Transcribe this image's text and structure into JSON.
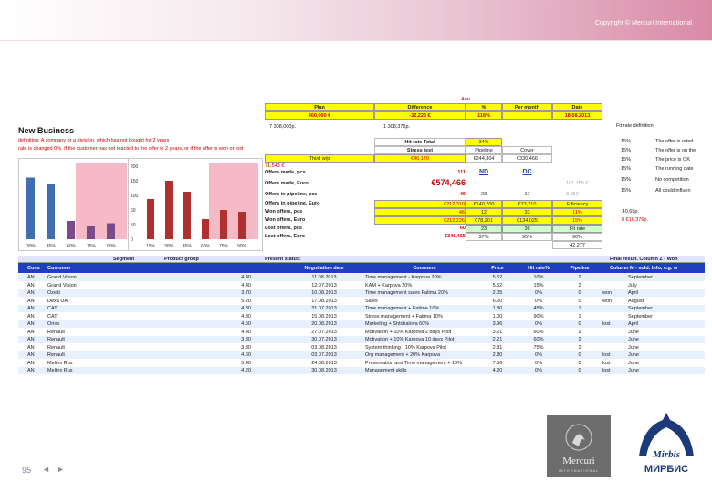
{
  "header": {
    "copyright": "Copyright © Mercuri International"
  },
  "slide": {
    "page_number": "95",
    "nav_prev": "◄",
    "nav_next": "►"
  },
  "sheet": {
    "section_title": "New Business",
    "definition_line1": "definition: A company or a division, which has not bought for 2 years",
    "definition_line2": "rate is changed 0%. If the customer has not reacted to the offer in 2 years, or if the offer is won or lost",
    "top_label": "Ann",
    "summary_headers": [
      "Plan",
      "Difference",
      "%",
      "Per month",
      "Date"
    ],
    "summary_values": [
      "460,000 €",
      "-32,226 €",
      "118%",
      "",
      "18.08.2013"
    ],
    "plan_rub": "7 308,000р.",
    "diff_rub": "1 308,376р.",
    "hit_rate_total_label": "Hit rate Total",
    "hit_rate_total_value": "34%",
    "stress_test_label": "Stress test",
    "pipeline_label": "Pipeline",
    "cover_label": "Cover",
    "pipeline_value": "€244,304",
    "cover_value": "€330,466",
    "sum_label": "Third w/p",
    "sum_value": "€46,170",
    "sum_value2": "71,543 €",
    "metrics": [
      {
        "label": "Offers made, pcs",
        "v1": "111",
        "v2": "ND",
        "v3": "DC"
      },
      {
        "label": "Offers made, Euro",
        "v1": "€574,466",
        "v2": "",
        "v3": ""
      },
      {
        "label": "Offers in pipeline, pcs",
        "v1": "46",
        "v2": "23",
        "v3": "17"
      },
      {
        "label": "Offers in pipeline, Euro",
        "v1": "€212,310",
        "v2": "€140,700",
        "v3": "€73,210"
      },
      {
        "label": "Won offers, pcs",
        "v1": "46",
        "v2": "12",
        "v3": "33"
      },
      {
        "label": "Won offers, Euro",
        "v1": "€212,226",
        "v2": "€78,201",
        "v3": "€134,025"
      },
      {
        "label": "Lost offers, pcs",
        "v1": "60",
        "v2": "23",
        "v3": "36"
      },
      {
        "label": "Lost offers, Euro",
        "v1": "€346,465",
        "v2": "",
        "v3": ""
      }
    ],
    "efficiency_label": "Efficiency",
    "efficiency_values": [
      "11%",
      "15%",
      "40.65р.",
      "8 616,376р."
    ],
    "hit_rate_row": [
      "37%",
      "95%",
      "Fit rate",
      "90%",
      "42,277"
    ],
    "right_percent_col": [
      "15%",
      "15%",
      "15%",
      "15%",
      "15%",
      "15%"
    ],
    "right_notes": [
      "The offer is rated",
      "The offer is on the",
      "The price is OK",
      "The running date",
      "No competition",
      "All could influen"
    ],
    "fit_definition": "Fit rate definition",
    "side_values": [
      "161,155 €",
      "3,052"
    ],
    "chart1": {
      "title": "",
      "xlabels": [
        "30%",
        "45%",
        "60%",
        "75%",
        "90%"
      ],
      "values": [
        135,
        120,
        40,
        30,
        35
      ]
    },
    "chart2": {
      "title": "",
      "xlabels": [
        "15%",
        "30%",
        "45%",
        "60%",
        "75%",
        "90%"
      ],
      "values": [
        110,
        160,
        130,
        55,
        80,
        75
      ],
      "yticks": [
        "200",
        "150",
        "100",
        "60",
        "50",
        "0"
      ]
    },
    "table": {
      "group_headers": [
        "Segment",
        "Product group",
        "Present status:",
        "Final result. Column Z - Won"
      ],
      "headers": [
        "Cons",
        "Customer",
        "Negotiation date",
        "Comment",
        "Price",
        "Hit rate%",
        "Pipeline",
        "Column M - sold. Info, e.g. w"
      ],
      "rows": [
        [
          "AN",
          "Grand Vision",
          "4.40",
          "11.08.2013",
          "Time management - Karpova 20%",
          "5.52",
          "10%",
          "2",
          "",
          "September"
        ],
        [
          "AN",
          "Grand Vision",
          "4.40",
          "12.07.2013",
          "KAM + Karpova 20%",
          "5.52",
          "15%",
          "2",
          "",
          "July"
        ],
        [
          "AN",
          "Ozeki",
          "3.70",
          "10.08.2013",
          "Time management sales Fatima 20%",
          "2.05",
          "0%",
          "0",
          "won",
          "April"
        ],
        [
          "AN",
          "Dexa UA",
          "5.20",
          "17.08.2013",
          "Sales",
          "6.20",
          "0%",
          "0",
          "won",
          "August"
        ],
        [
          "AN",
          "CAT",
          "4.30",
          "31.07.2013",
          "Time management + Fatima 10%",
          "1.80",
          "45%",
          "1",
          "",
          "September"
        ],
        [
          "AN",
          "CAT",
          "4.30",
          "15.08.2013",
          "Stress management + Fatima 10%",
          "1.00",
          "90%",
          "1",
          "",
          "September"
        ],
        [
          "AN",
          "Orion",
          "4.50",
          "20.08.2013",
          "Marketing + Shtokalova 60%",
          "3.96",
          "0%",
          "0",
          "lost",
          "April"
        ],
        [
          "AN",
          "Renault",
          "4.40",
          "27.07.2013",
          "Motivation + 10% Karpova 2 days Pilot",
          "3.21",
          "60%",
          "2",
          "",
          "June"
        ],
        [
          "AN",
          "Renault",
          "3.30",
          "30.07.2013",
          "Motivation + 10% Karpova 10 days Pilot",
          "2.21",
          "60%",
          "2",
          "",
          "June"
        ],
        [
          "AN",
          "Renault",
          "3.30",
          "03.08.2013",
          "System thinking - 10% Karpova Pilot",
          "2.81",
          "75%",
          "2",
          "",
          "June"
        ],
        [
          "AN",
          "Renault",
          "4.60",
          "03.07.2013",
          "Org management + 20% Karpova",
          "2.80",
          "0%",
          "0",
          "lost",
          "June"
        ],
        [
          "AN",
          "Meltex Rus",
          "5.40",
          "24.08.2013",
          "Presentation and Time management + 10%",
          "7.56",
          "0%",
          "0",
          "lost",
          "June"
        ],
        [
          "AN",
          "Meltex Rus",
          "4.20",
          "30.08.2013",
          "Management skills",
          "4.20",
          "0%",
          "0",
          "lost",
          "June"
        ]
      ]
    }
  },
  "logos": {
    "mercuri_name": "Mercuri",
    "mercuri_sub": "INTERNATIONAL",
    "mirbis_latin": "Mirbis",
    "mirbis_cyr": "МИРБИС"
  },
  "colors": {
    "header_pink": "#d98aa6",
    "highlight_yellow": "#ffff00",
    "table_blue": "#1f3fbf",
    "bar_red": "#b03030",
    "bar_blue": "#3f6fb0",
    "bar_purple": "#7a4a8a"
  }
}
